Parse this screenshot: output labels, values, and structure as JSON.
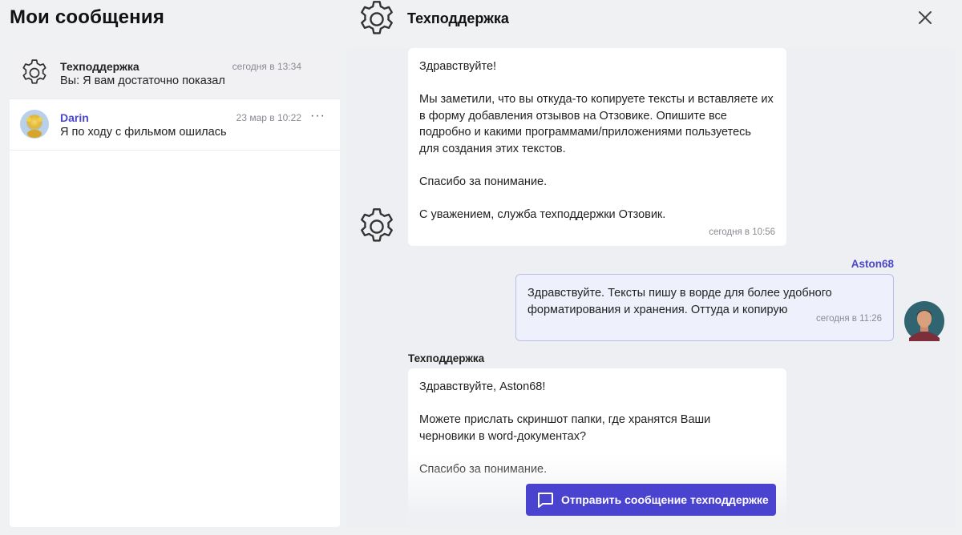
{
  "page_title": "Мои сообщения",
  "chat_header": {
    "title": "Техподдержка",
    "icon": "gear-icon",
    "close_icon": "close-icon"
  },
  "conversations": [
    {
      "name": "Техподдержка",
      "preview": "Вы: Я вам достаточно показал",
      "time": "сегодня в 13:34",
      "avatar": "gear-icon",
      "active": true
    },
    {
      "name": "Darin",
      "preview": "Я по ходу с фильмом ошилась",
      "time": "23 мар в 10:22",
      "avatar": "user-avatar",
      "more": "···"
    }
  ],
  "messages": [
    {
      "sender": "Техподдержка",
      "lines_p1": "Здравствуйте!",
      "lines_p2": [
        "Мы заметили, что вы откуда-то копируете тексты и вставляете их",
        "в форму добавления отзывов на Отзовике. Опишите все",
        "подробно и какими программами/приложениями пользуетесь",
        "для создания этих текстов."
      ],
      "lines_p3": "Спасибо за понимание.",
      "lines_p4": "С уважением, служба техподдержки Отзовик.",
      "time": "сегодня в 10:56"
    },
    {
      "sender": "Aston68",
      "lines": [
        "Здравствуйте. Тексты пишу в ворде для более удобного",
        "форматирования и хранения. Оттуда и копирую"
      ],
      "time": "сегодня в 11:26"
    },
    {
      "sender": "Техподдержка",
      "lines_p1": "Здравствуйте, Aston68!",
      "lines_p2": [
        "Можете прислать скриншот папки, где хранятся Ваши",
        "черновики в word-документах?"
      ],
      "lines_p3": "Спасибо за понимание."
    }
  ],
  "send_button": {
    "label": "Отправить сообщение техподдержке",
    "icon": "chat-bubble-icon"
  },
  "colors": {
    "accent": "#4a43cf",
    "name_blue": "#4a47c9",
    "own_bubble": "#eef0fb"
  }
}
